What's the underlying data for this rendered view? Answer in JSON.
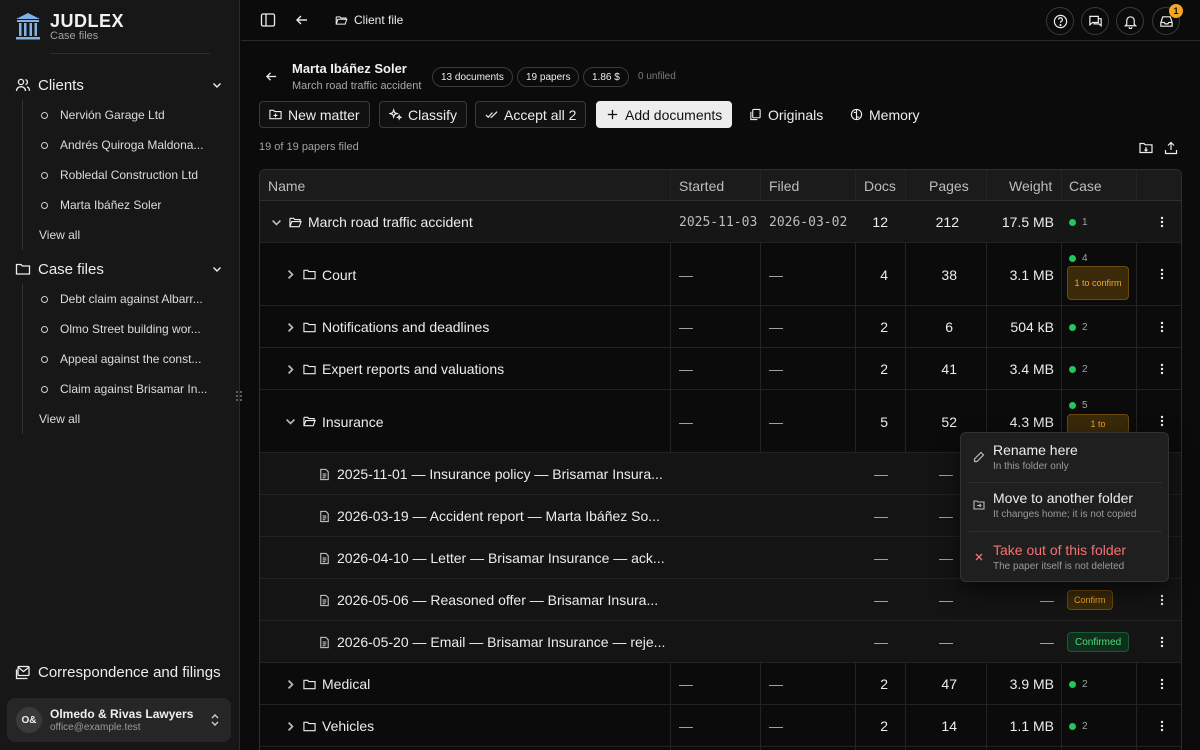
{
  "brand": {
    "name": "JUDLEX",
    "subtitle": "Case files"
  },
  "sidebar": {
    "clients": {
      "label": "Clients",
      "items": [
        "Nervión Garage Ltd",
        "Andrés Quiroga Maldona...",
        "Robledal Construction Ltd",
        "Marta Ibáñez Soler"
      ],
      "view_all": "View all"
    },
    "case_files": {
      "label": "Case files",
      "items": [
        "Debt claim against Albarr...",
        "Olmo Street building wor...",
        "Appeal against the const...",
        "Claim against Brisamar In..."
      ],
      "view_all": "View all"
    },
    "correspondence": "Correspondence and filings",
    "account": {
      "initials": "O&",
      "name": "Olmedo & Rivas Lawyers",
      "email": "office@example.test"
    }
  },
  "topbar": {
    "breadcrumb": "Client file",
    "notifications_count": "1"
  },
  "header": {
    "client_name": "Marta Ibáñez Soler",
    "matter": "March road traffic accident",
    "pills": [
      "13 documents",
      "19 papers",
      "1.86 $"
    ],
    "unfiled": "0 unfiled"
  },
  "toolbar": {
    "new_matter": "New matter",
    "classify": "Classify",
    "accept_all": "Accept all 2",
    "add_documents": "Add documents",
    "originals": "Originals",
    "memory": "Memory"
  },
  "filed_count": "19 of 19 papers filed",
  "table": {
    "columns": {
      "name": "Name",
      "started": "Started",
      "filed": "Filed",
      "docs": "Docs",
      "pages": "Pages",
      "weight": "Weight",
      "case": "Case"
    },
    "rows": [
      {
        "name": "March road traffic accident",
        "started": "2025-11-03",
        "filed": "2026-03-02",
        "docs": "12",
        "pages": "212",
        "weight": "17.5 MB",
        "case_n": "1"
      },
      {
        "name": "Court",
        "started": "—",
        "filed": "—",
        "docs": "4",
        "pages": "38",
        "weight": "3.1 MB",
        "case_n": "4",
        "badge": "1 to confirm"
      },
      {
        "name": "Notifications and deadlines",
        "started": "—",
        "filed": "—",
        "docs": "2",
        "pages": "6",
        "weight": "504 kB",
        "case_n": "2"
      },
      {
        "name": "Expert reports and valuations",
        "started": "—",
        "filed": "—",
        "docs": "2",
        "pages": "41",
        "weight": "3.4 MB",
        "case_n": "2"
      },
      {
        "name": "Insurance",
        "started": "—",
        "filed": "—",
        "docs": "5",
        "pages": "52",
        "weight": "4.3 MB",
        "case_n": "5",
        "badge": "1 to"
      },
      {
        "name": "2025-11-01 — Insurance policy — Brisamar Insura...",
        "docs": "—",
        "pages": "—"
      },
      {
        "name": "2026-03-19 — Accident report — Marta Ibáñez So...",
        "docs": "—",
        "pages": "—"
      },
      {
        "name": "2026-04-10 — Letter — Brisamar Insurance — ack...",
        "docs": "—",
        "pages": "—"
      },
      {
        "name": "2026-05-06 — Reasoned offer — Brisamar Insura...",
        "docs": "—",
        "pages": "—",
        "weight": "—",
        "badge": "Confirm"
      },
      {
        "name": "2026-05-20 — Email — Brisamar Insurance — reje...",
        "docs": "—",
        "pages": "—",
        "weight": "—",
        "badge": "Confirmed"
      },
      {
        "name": "Medical",
        "started": "—",
        "filed": "—",
        "docs": "2",
        "pages": "47",
        "weight": "3.9 MB",
        "case_n": "2"
      },
      {
        "name": "Vehicles",
        "started": "—",
        "filed": "—",
        "docs": "2",
        "pages": "14",
        "weight": "1.1 MB",
        "case_n": "2"
      }
    ]
  },
  "context_menu": {
    "rename": {
      "title": "Rename here",
      "sub": "In this folder only"
    },
    "move": {
      "title": "Move to another folder",
      "sub": "It changes home; it is not copied"
    },
    "remove": {
      "title": "Take out of this folder",
      "sub": "The paper itself is not deleted"
    }
  },
  "colors": {
    "accent_green": "#22c55e",
    "warning": "#f5a623",
    "danger": "#f87171"
  }
}
